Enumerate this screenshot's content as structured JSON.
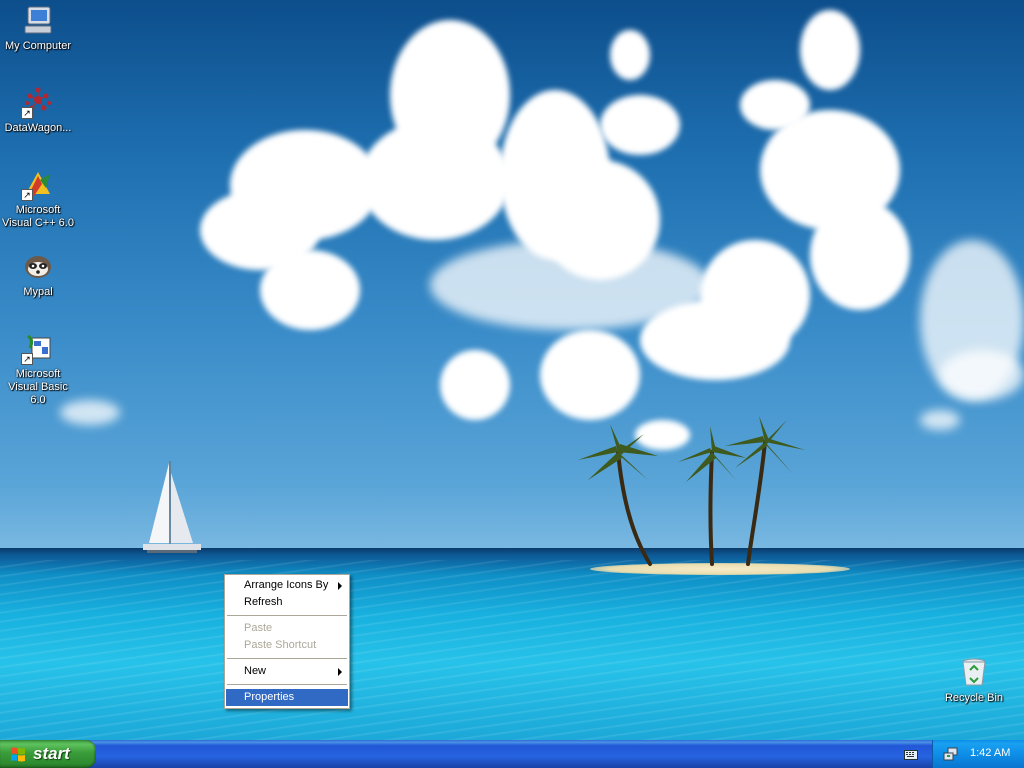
{
  "desktop": {
    "icons": [
      {
        "label": "My Computer"
      },
      {
        "label": "DataWagon..."
      },
      {
        "label": "Microsoft Visual C++ 6.0"
      },
      {
        "label": "Mypal"
      },
      {
        "label": "Microsoft Visual Basic 6.0"
      },
      {
        "label": "Recycle Bin"
      }
    ]
  },
  "context_menu": {
    "items": [
      {
        "label": "Arrange Icons By",
        "enabled": true,
        "submenu": true
      },
      {
        "label": "Refresh",
        "enabled": true
      },
      {
        "label": "Paste",
        "enabled": false
      },
      {
        "label": "Paste Shortcut",
        "enabled": false
      },
      {
        "label": "New",
        "enabled": true,
        "submenu": true
      },
      {
        "label": "Properties",
        "enabled": true,
        "selected": true
      }
    ]
  },
  "taskbar": {
    "start_label": "start",
    "clock": "1:42 AM"
  },
  "colors": {
    "menu_highlight": "#316ac5",
    "taskbar_blue": "#2663e0",
    "start_green": "#3a9d3a",
    "tray_blue": "#0e8ee8"
  }
}
